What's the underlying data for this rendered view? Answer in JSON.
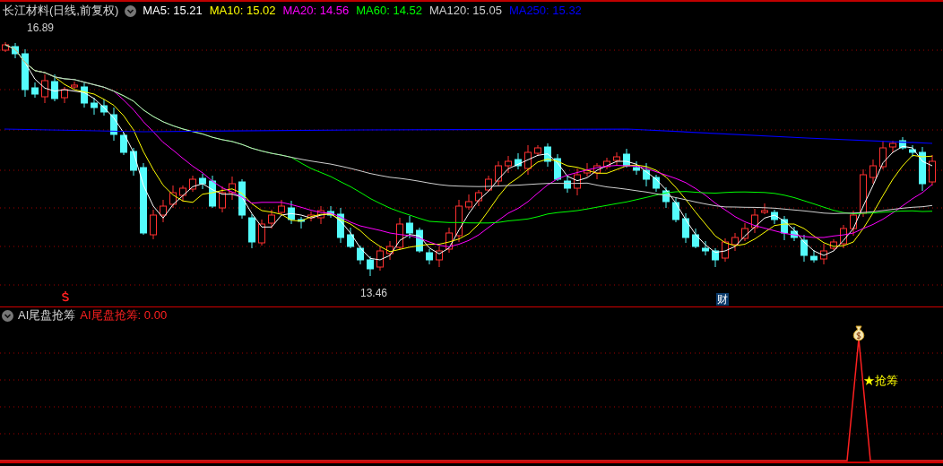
{
  "header": {
    "title": "长江材料(日线,前复权)",
    "indicators": [
      {
        "label": "MA5:",
        "value": "15.21",
        "color": "#ffffff"
      },
      {
        "label": "MA10:",
        "value": "15.02",
        "color": "#ffff00"
      },
      {
        "label": "MA20:",
        "value": "14.56",
        "color": "#ff00ff"
      },
      {
        "label": "MA60:",
        "value": "14.52",
        "color": "#00ff00"
      },
      {
        "label": "MA120:",
        "value": "15.05",
        "color": "#d0d0d0"
      },
      {
        "label": "MA250:",
        "value": "15.32",
        "color": "#0000ff"
      }
    ]
  },
  "price_chart": {
    "high_label": "16.89",
    "low_label": "13.46",
    "badge": "财"
  },
  "sub_panel": {
    "title": "AI尾盘抢筹",
    "reading": {
      "label": "AI尾盘抢筹:",
      "value": "0.00"
    },
    "signal_label": "★抢筹"
  }
}
